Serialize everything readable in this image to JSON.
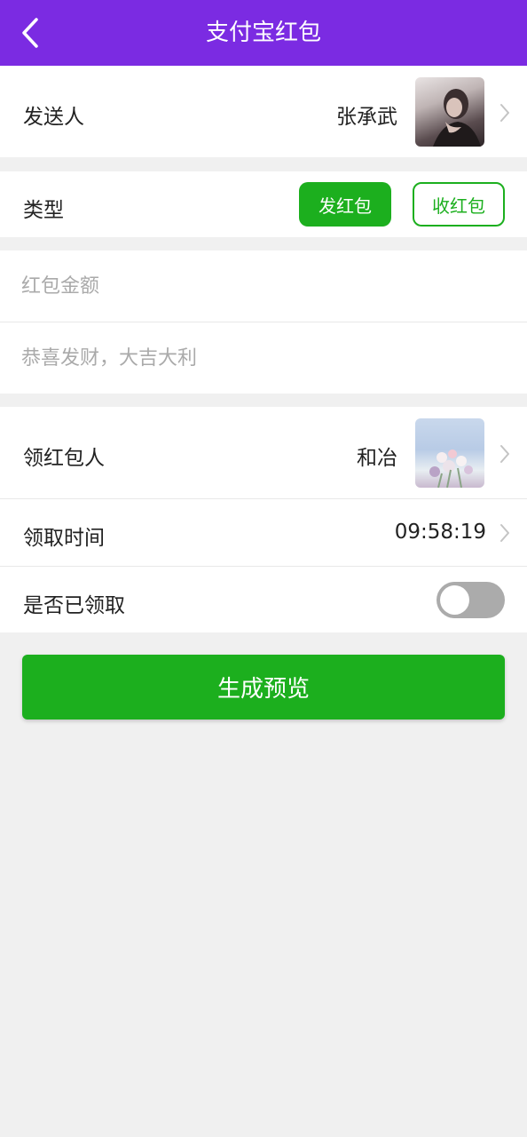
{
  "header": {
    "title": "支付宝红包",
    "bg_color": "#7b2be2"
  },
  "sender": {
    "label": "发送人",
    "name": "张承武"
  },
  "type": {
    "label": "类型",
    "send_label": "发红包",
    "receive_label": "收红包",
    "selected": "发红包"
  },
  "amount": {
    "placeholder": "红包金额",
    "value": ""
  },
  "message": {
    "placeholder": "恭喜发财，大吉大利",
    "value": ""
  },
  "receiver": {
    "label": "领红包人",
    "name": "和冶"
  },
  "receive_time": {
    "label": "领取时间",
    "value": "09:58:19"
  },
  "received": {
    "label": "是否已领取",
    "checked": false
  },
  "action": {
    "generate_label": "生成预览",
    "color": "#1caf1e"
  },
  "icons": {
    "back": "back-arrow-icon",
    "chevron": "chevron-right-icon"
  }
}
